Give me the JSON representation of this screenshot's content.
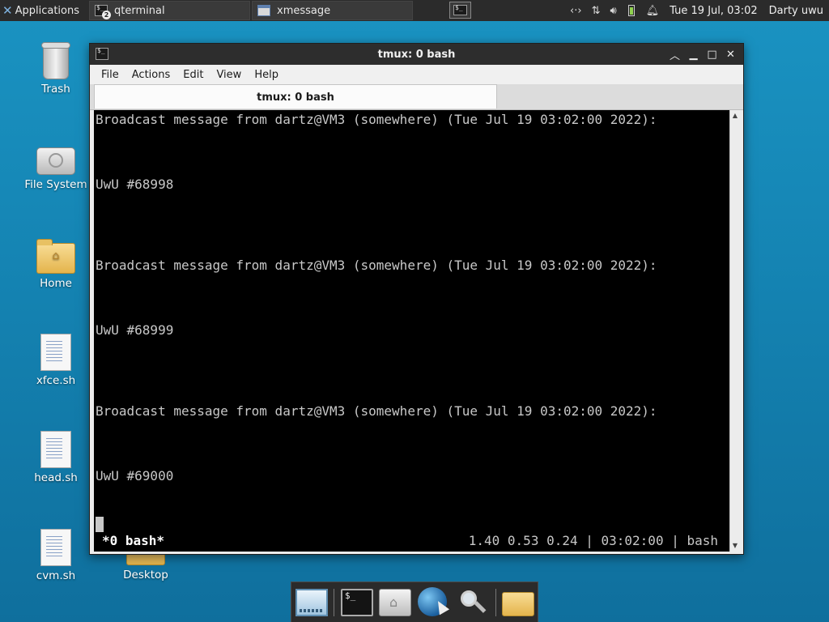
{
  "panel": {
    "applications_label": "Applications",
    "tasks": [
      {
        "label": "qterminal",
        "badge": "2"
      },
      {
        "label": "xmessage"
      }
    ],
    "clock": "Tue 19 Jul, 03:02",
    "user": "Darty uwu",
    "battery_color": "#8fd14f"
  },
  "desktop": {
    "icons": [
      {
        "label": "Trash",
        "icon": "trash-icon"
      },
      {
        "label": "File System",
        "icon": "drive-icon"
      },
      {
        "label": "Home",
        "icon": "home-folder-icon"
      },
      {
        "label": "xfce.sh",
        "icon": "script-file-icon"
      },
      {
        "label": "head.sh",
        "icon": "script-file-icon"
      },
      {
        "label": "cvm.sh",
        "icon": "script-file-icon"
      },
      {
        "label": "Desktop",
        "icon": "folder-icon"
      }
    ]
  },
  "window": {
    "title": "tmux: 0 bash",
    "menu": [
      "File",
      "Actions",
      "Edit",
      "View",
      "Help"
    ],
    "tab_label": "tmux: 0 bash",
    "terminal_lines": [
      "Broadcast message from dartz@VM3 (somewhere) (Tue Jul 19 03:02:00 2022):",
      "UwU #68998",
      "Broadcast message from dartz@VM3 (somewhere) (Tue Jul 19 03:02:00 2022):",
      "UwU #68999",
      "Broadcast message from dartz@VM3 (somewhere) (Tue Jul 19 03:02:00 2022):",
      "UwU #69000"
    ],
    "status_left": "*0 bash*",
    "status_right": "1.40 0.53 0.24 | 03:02:00 | bash"
  },
  "dock": {
    "items": [
      "show-desktop-icon",
      "terminal-icon",
      "home-icon",
      "web-browser-icon",
      "search-icon",
      "folder-icon"
    ]
  }
}
